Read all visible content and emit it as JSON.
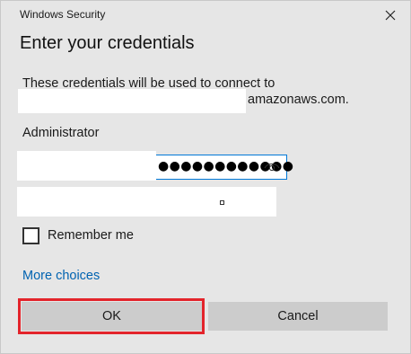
{
  "window": {
    "title": "Windows Security",
    "close_icon": "close-icon"
  },
  "dialog": {
    "heading": "Enter your credentials",
    "message": "These credentials will be used to connect to",
    "host_suffix": "amazonaws.com.",
    "username": "Administrator"
  },
  "password": {
    "masked_value": "●●●●●●●●●●●●",
    "reveal_icon": "eye-icon"
  },
  "remember": {
    "label": "Remember me",
    "checked": false
  },
  "links": {
    "more_choices": "More choices"
  },
  "buttons": {
    "ok": "OK",
    "cancel": "Cancel"
  },
  "colors": {
    "accent": "#0078d7",
    "link": "#0063b1",
    "highlight": "#e3242b",
    "button_bg": "#cccccc",
    "dialog_bg": "#e6e6e6"
  }
}
